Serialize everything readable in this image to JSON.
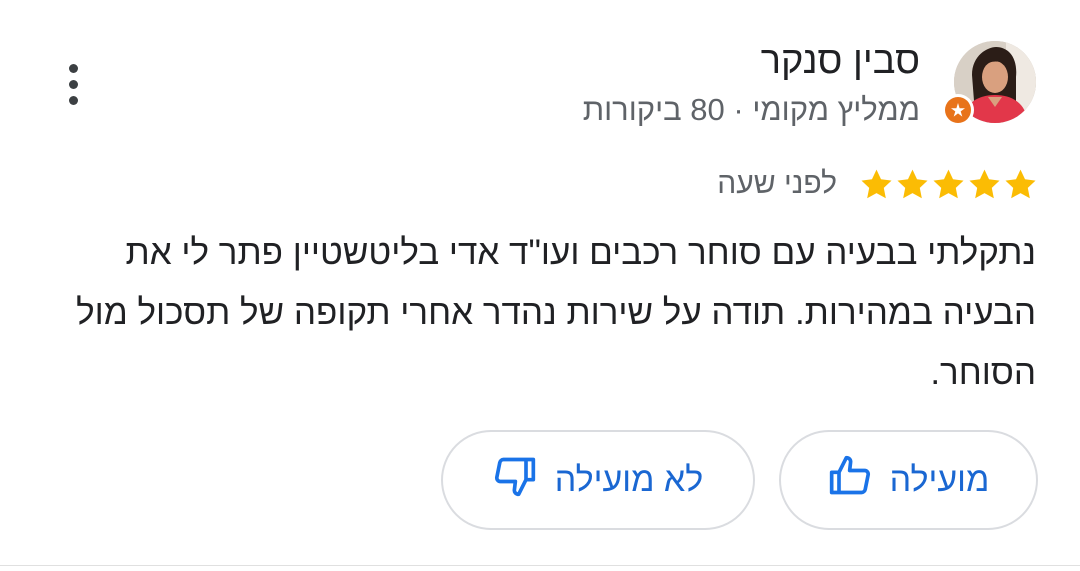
{
  "reviewer": {
    "name": "סבין סנקר",
    "meta": "ממליץ מקומי · 80 ביקורות",
    "avatar_icon": "user-photo",
    "badge_icon": "local-guide-star-icon",
    "badge_color": "#e8731a"
  },
  "menu_icon": "more-vert-icon",
  "rating": {
    "stars": 5,
    "max_stars": 5,
    "star_color": "#fbbc04",
    "time_ago": "לפני שעה"
  },
  "review_text": "נתקלתי בבעיה עם סוחר רכבים ועו\"ד אדי בליטשטיין פתר לי את הבעיה במהירות. תודה על שירות נהדר אחרי תקופה של תסכול מול הסוחר.",
  "actions": {
    "helpful_label": "מועילה",
    "helpful_icon": "thumb-up-icon",
    "not_helpful_label": "לא מועילה",
    "not_helpful_icon": "thumb-down-icon",
    "accent_color": "#1a73e8"
  }
}
